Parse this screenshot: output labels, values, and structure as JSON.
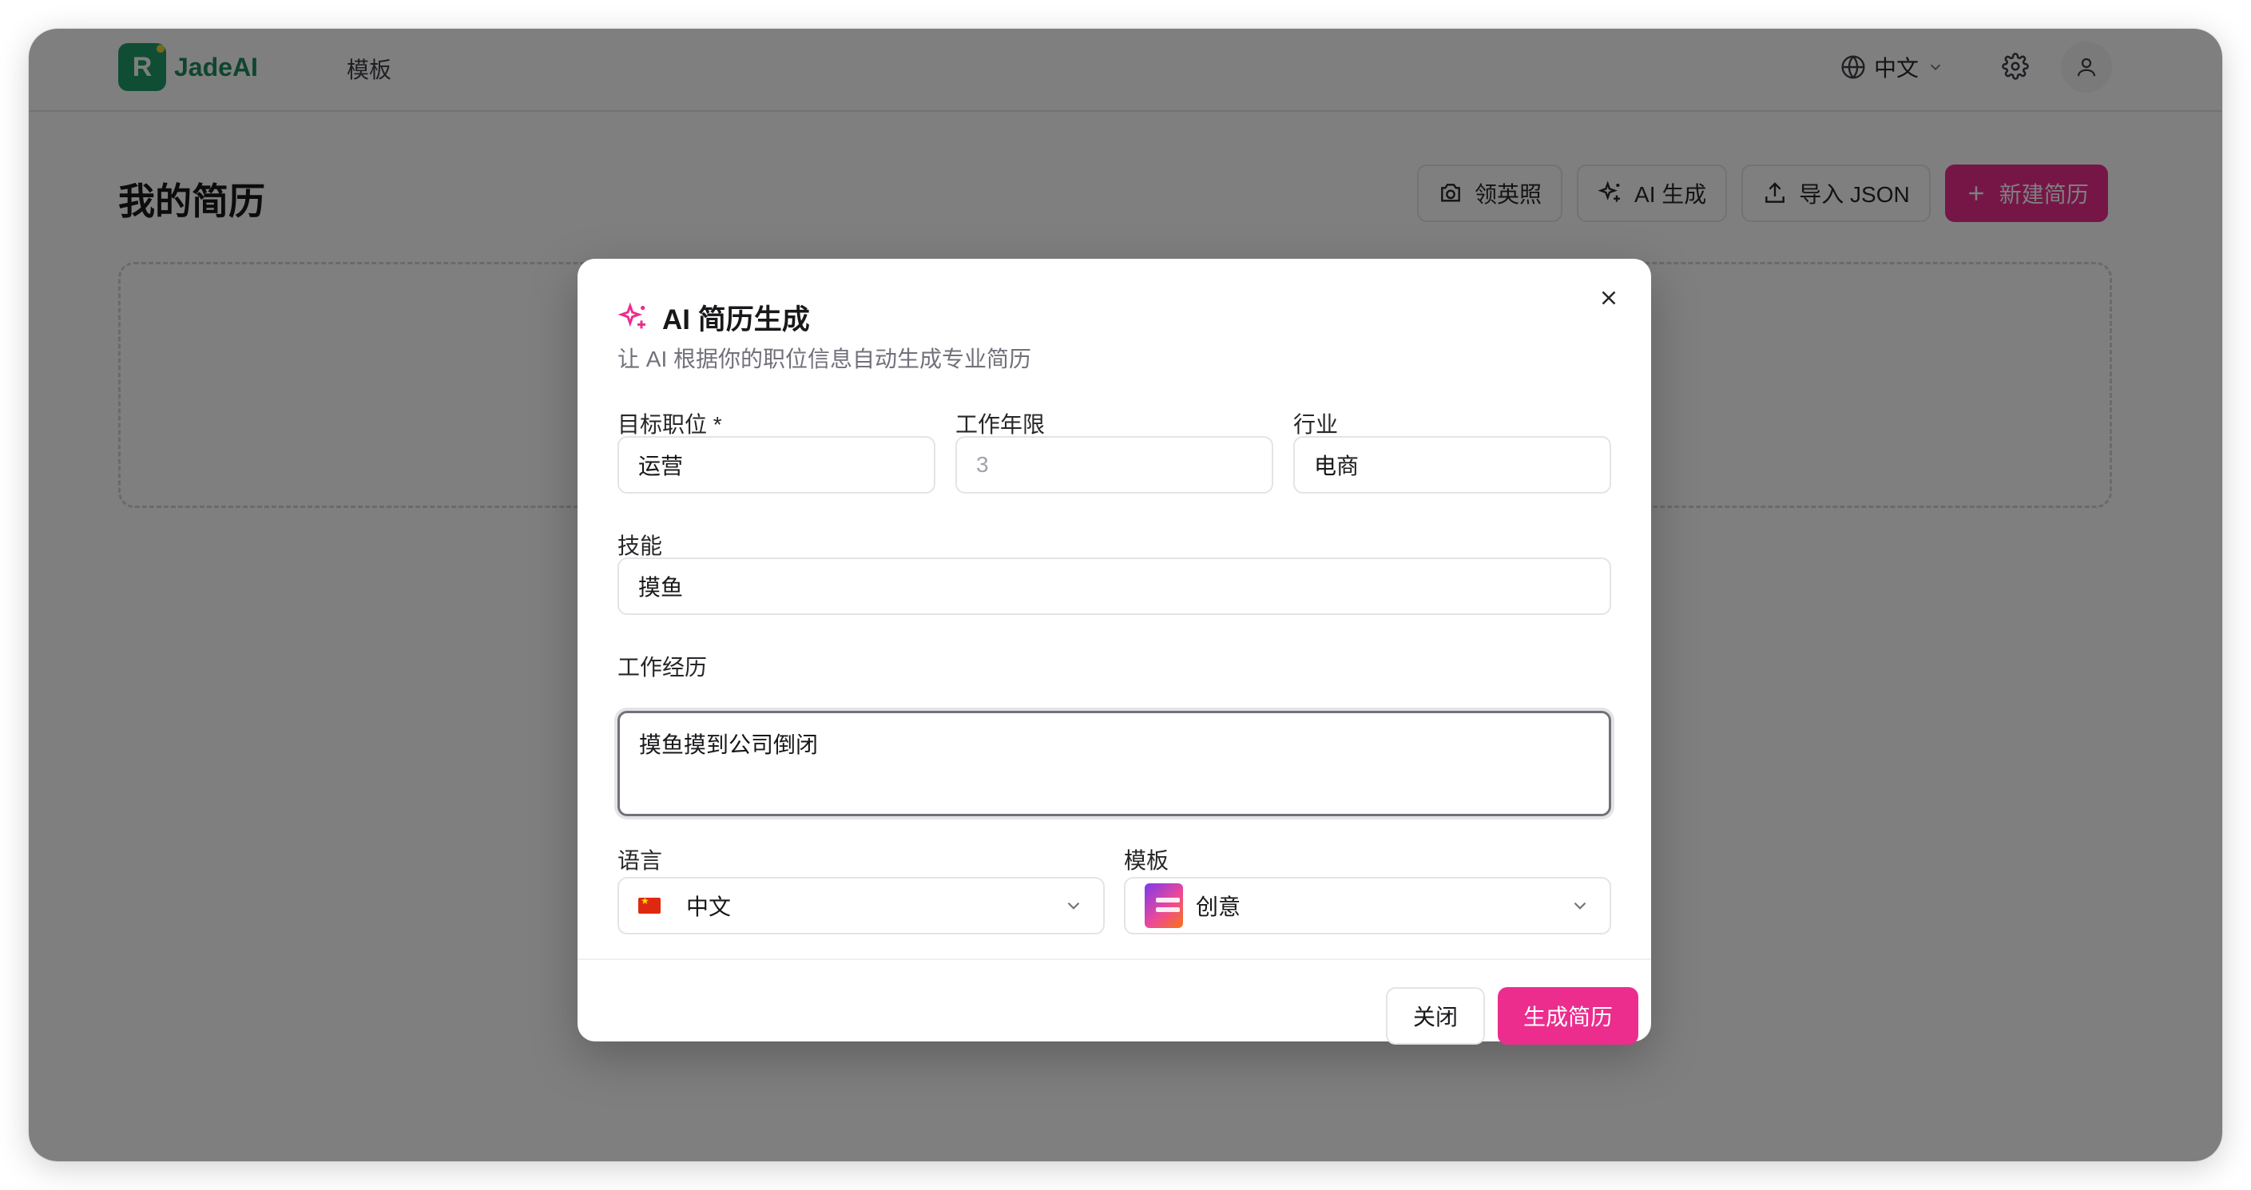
{
  "app": {
    "name": "JadeAI",
    "logo_letter": "R"
  },
  "nav": {
    "templates": "模板"
  },
  "header": {
    "language": "中文"
  },
  "page": {
    "title": "我的简历"
  },
  "actions": {
    "linkedin": "领英照",
    "ai_generate": "AI 生成",
    "import_json": "导入 JSON",
    "new_resume": "新建简历"
  },
  "dialog": {
    "title": "AI 简历生成",
    "description": "让 AI 根据你的职位信息自动生成专业简历",
    "fields": {
      "target_position": {
        "label": "目标职位 *",
        "value": "运营"
      },
      "years": {
        "label": "工作年限",
        "placeholder": "3",
        "value": ""
      },
      "industry": {
        "label": "行业",
        "value": "电商"
      },
      "skills": {
        "label": "技能",
        "value": "摸鱼"
      },
      "experience": {
        "label": "工作经历",
        "value": "摸鱼摸到公司倒闭"
      },
      "language": {
        "label": "语言",
        "value": "中文"
      },
      "template": {
        "label": "模板",
        "value": "创意"
      }
    },
    "buttons": {
      "close": "关闭",
      "generate": "生成简历"
    }
  },
  "colors": {
    "brand": "#1f9d6b",
    "accent": "#ec2d8e"
  }
}
